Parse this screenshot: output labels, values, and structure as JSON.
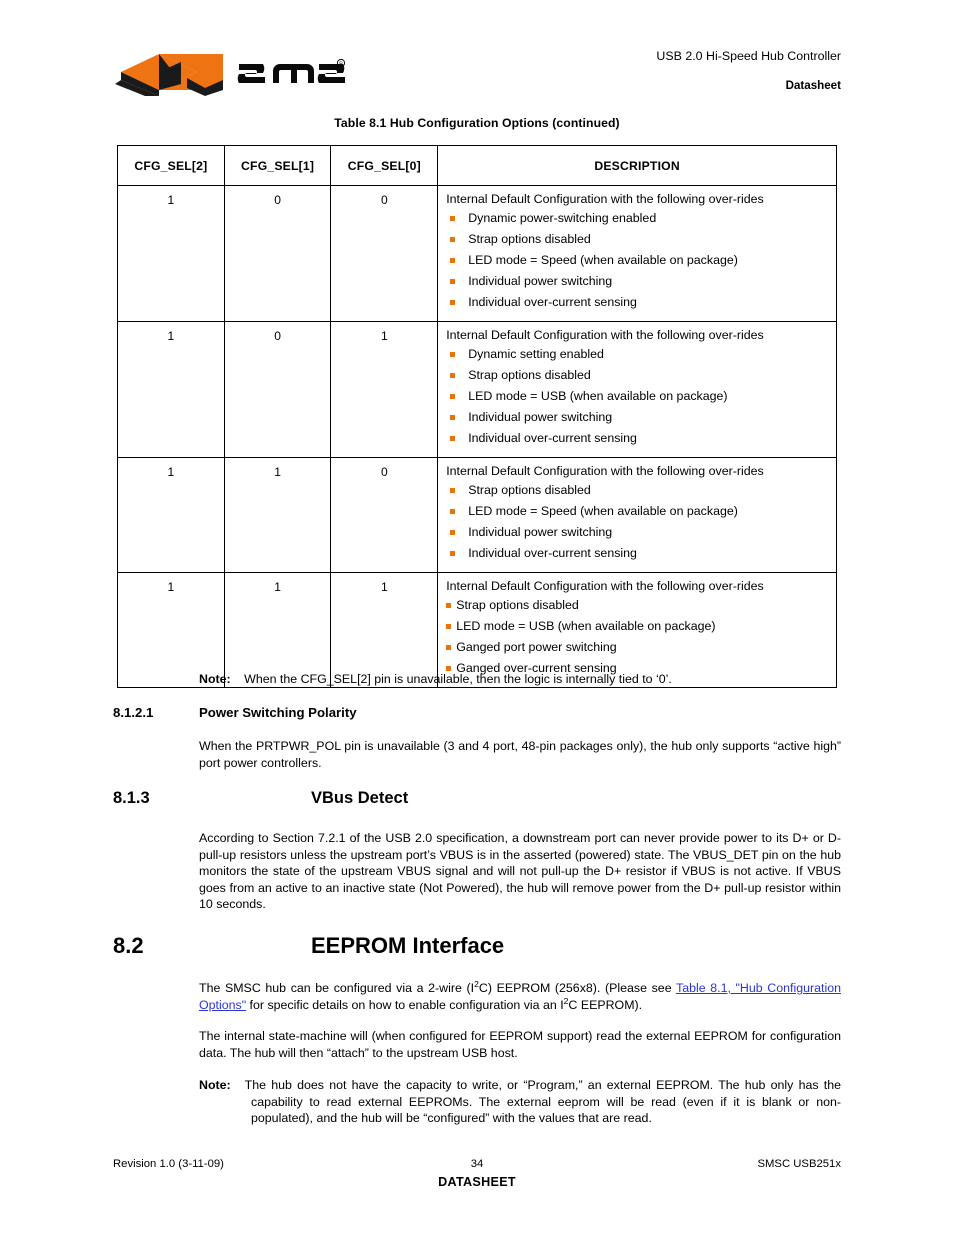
{
  "header": {
    "product_line": "USB 2.0 Hi-Speed Hub Controller",
    "doc_type": "Datasheet",
    "logo_text": "smsc",
    "logo_registered": "®",
    "logo_orange": "#EE7312",
    "logo_black": "#1A1A1A"
  },
  "table": {
    "caption": "Table 8.1  Hub Configuration Options (continued)",
    "columns": [
      "CFG_SEL[2]",
      "CFG_SEL[1]",
      "CFG_SEL[0]",
      "DESCRIPTION"
    ],
    "bullet_color": "#E8730C",
    "rows": [
      {
        "sel2": "1",
        "sel1": "0",
        "sel0": "0",
        "desc_title": "Internal Default Configuration with the following over-rides",
        "bullets": [
          "Dynamic power-switching enabled",
          "Strap options disabled",
          "LED mode = Speed (when available on package)",
          "Individual power switching",
          "Individual over-current sensing"
        ]
      },
      {
        "sel2": "1",
        "sel1": "0",
        "sel0": "1",
        "desc_title": "Internal Default Configuration with the following over-rides",
        "bullets": [
          "Dynamic setting enabled",
          "Strap options disabled",
          "LED mode = USB (when available on package)",
          "Individual power switching",
          "Individual over-current sensing"
        ]
      },
      {
        "sel2": "1",
        "sel1": "1",
        "sel0": "0",
        "desc_title": "Internal Default Configuration with the following over-rides",
        "bullets": [
          "Strap options disabled",
          "LED mode = Speed (when available on package)",
          "Individual power switching",
          "Individual over-current sensing"
        ]
      },
      {
        "sel2": "1",
        "sel1": "1",
        "sel0": "1",
        "desc_title": "Internal Default Configuration with the following over-rides",
        "bullets": [
          "Strap options disabled",
          "LED mode = USB (when available on package)",
          "Ganged port power switching",
          "Ganged over-current sensing"
        ]
      }
    ]
  },
  "note1": {
    "label": "Note:",
    "text": "When the CFG_SEL[2] pin is unavailable, then the logic is internally tied to ‘0’."
  },
  "section_8121": {
    "number": "8.1.2.1",
    "title": "Power Switching Polarity",
    "body": "When the PRTPWR_POL pin is unavailable (3 and 4 port, 48-pin packages only), the hub only supports “active high” port power controllers."
  },
  "section_813": {
    "number": "8.1.3",
    "title": "VBus Detect",
    "body": "According to Section 7.2.1 of the USB 2.0 specification, a downstream port can never provide power to its D+ or D- pull-up resistors unless the upstream port’s VBUS is in the asserted (powered) state. The VBUS_DET pin on the hub monitors the state of the upstream VBUS signal and will not pull-up the D+ resistor if VBUS is not active. If VBUS goes from an active to an inactive state (Not Powered), the hub will remove power from the D+ pull-up resistor within 10 seconds."
  },
  "section_82": {
    "number": "8.2",
    "title": "EEPROM Interface",
    "para1_part1": "The SMSC hub can be configured via a 2-wire (I",
    "para1_sup1": "2",
    "para1_part2": "C) EEPROM (256x8). (Please see ",
    "para1_link": "Table 8.1, \"Hub Configuration Options\"",
    "para1_part3": " for specific details on how to enable configuration via an I",
    "para1_sup2": "2",
    "para1_part4": "C EEPROM).",
    "link_color": "#2B35D6",
    "para2": "The internal state-machine will (when configured for EEPROM support) read the external EEPROM for configuration data. The hub will then “attach” to the upstream USB host.",
    "note_label": "Note:",
    "note_text": "The hub does not have the capacity to write, or “Program,” an external EEPROM. The hub only has the capability to read external EEPROMs. The external eeprom will be read (even if it is blank or non-populated), and the hub will be “configured” with the values that are read."
  },
  "footer": {
    "revision": "Revision 1.0 (3-11-09)",
    "page_number": "34",
    "doc_label": "DATASHEET",
    "part_number": "SMSC USB251x"
  }
}
